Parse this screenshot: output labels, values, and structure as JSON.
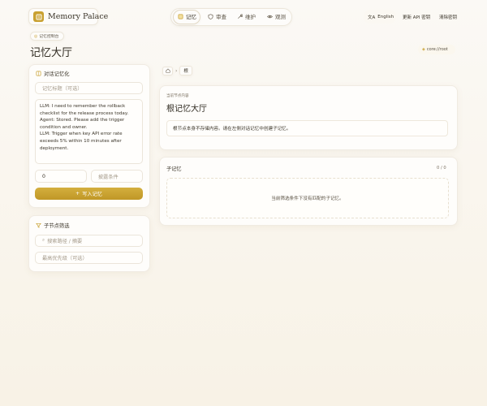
{
  "brand": {
    "name": "Memory Palace",
    "logo_glyph": "≡"
  },
  "nav": {
    "items": [
      {
        "label": "记忆",
        "icon": "book-icon",
        "active": true
      },
      {
        "label": "审查",
        "icon": "shield-icon",
        "active": false
      },
      {
        "label": "维护",
        "icon": "wrench-icon",
        "active": false
      },
      {
        "label": "观测",
        "icon": "eye-icon",
        "active": false
      }
    ]
  },
  "header": {
    "language": "English",
    "update_key": "更新 API 密钥",
    "clear_key": "清除密钥"
  },
  "breadcrumb_badge": "记忆控制台",
  "page_title": "记忆大厅",
  "root_path": "core://root",
  "left_panel": {
    "title": "对话记忆化",
    "title_placeholder": "记忆标题（可选）",
    "conversation_text": "LLM: I need to remember the rollback checklist for the release process today.\nAgent: Stored. Please add the trigger condition and owner.\nLLM: Trigger when key API error rate exceeds 5% within 10 minutes after deployment.",
    "priority_value": "0",
    "trigger_placeholder": "披露条件",
    "submit_label": "写入记忆"
  },
  "filter_panel": {
    "title": "子节点筛选",
    "search_placeholder": "搜索路径 / 摘要",
    "priority_placeholder": "最高优先级（可选）"
  },
  "breadcrumb": {
    "current": "根"
  },
  "node_card": {
    "eyebrow": "当前节点内容",
    "title": "根记忆大厅",
    "message": "根节点本身不存储内容。请在左侧对话记忆中创建子记忆。"
  },
  "children_card": {
    "title": "子记忆",
    "count": "0 / 0",
    "empty": "当前筛选条件下没有匹配的子记忆。"
  },
  "colors": {
    "accent_gold": "#c9a132",
    "background": "#f8f2e6",
    "text": "#3a3428"
  }
}
